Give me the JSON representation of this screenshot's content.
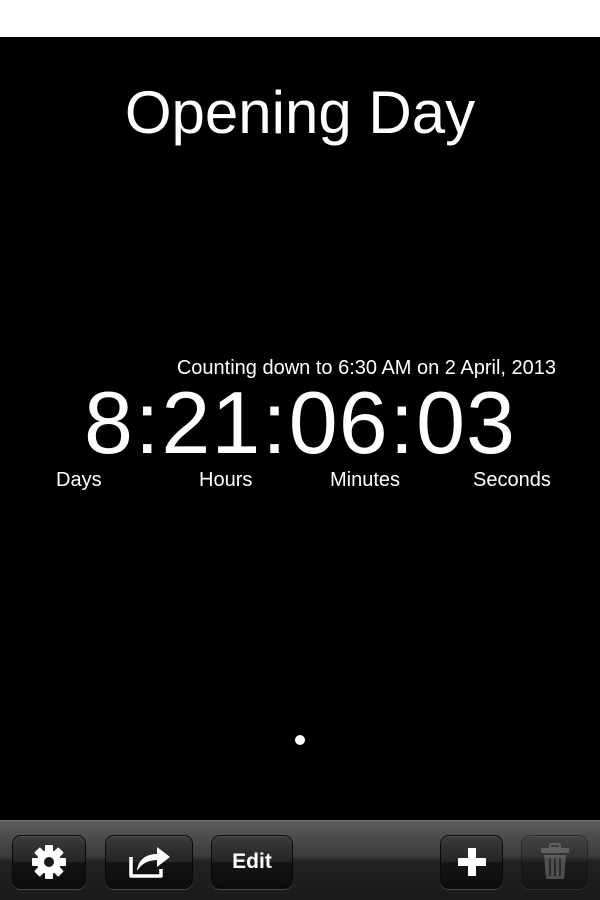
{
  "screen": {
    "title": "Opening Day",
    "target_text": "Counting down to 6:30 AM on 2 April, 2013",
    "countdown": {
      "days": "8",
      "hours": "21",
      "minutes": "06",
      "seconds": "03",
      "separator": ":"
    },
    "units": {
      "days": "Days",
      "hours": "Hours",
      "minutes": "Minutes",
      "seconds": "Seconds"
    },
    "page_indicator": {
      "pages": 1,
      "current": 1
    }
  },
  "toolbar": {
    "settings_icon": "gear-icon",
    "share_icon": "share-arrow-icon",
    "edit_label": "Edit",
    "add_icon": "plus-icon",
    "trash_icon": "trash-icon",
    "trash_enabled": false
  },
  "colors": {
    "background": "#000000",
    "text": "#ffffff",
    "toolbar": "#2a2a2a"
  }
}
